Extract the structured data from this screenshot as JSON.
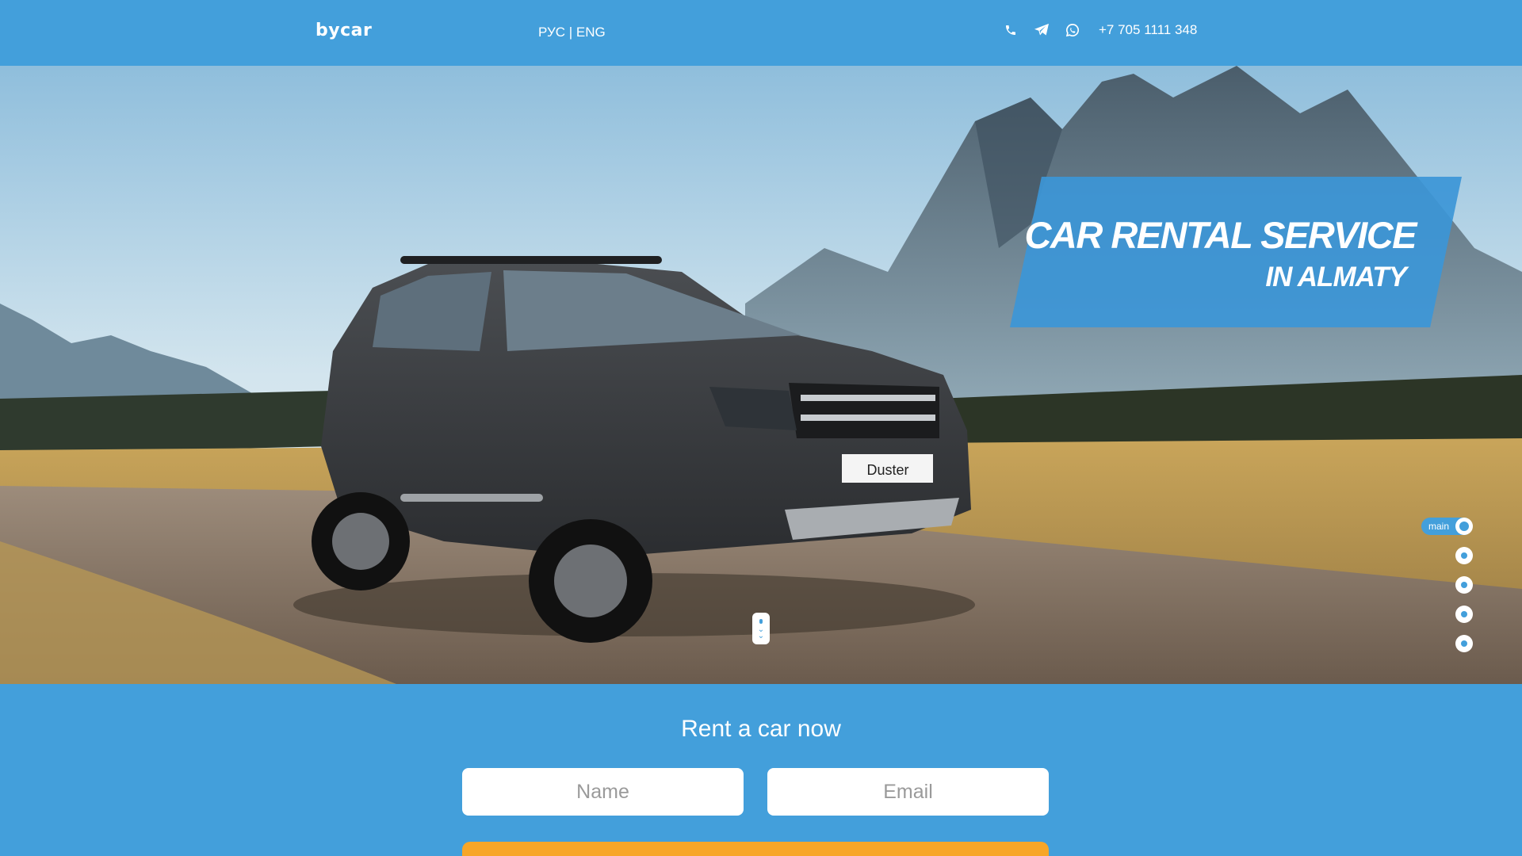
{
  "header": {
    "logo": "bycar",
    "lang_ru": "РУС",
    "lang_sep": " | ",
    "lang_en": "ENG",
    "icons": [
      "phone-icon",
      "telegram-icon",
      "whatsapp-icon"
    ],
    "phone": "+7 705 1111 348"
  },
  "hero": {
    "title_line1": "CAR RENTAL SERVICE",
    "title_line2": "IN ALMATY",
    "car_plate": "Duster",
    "nav": {
      "active_label": "main",
      "dot_count": 5
    }
  },
  "form": {
    "title": "Rent a car now",
    "name_placeholder": "Name",
    "email_placeholder": "Email"
  },
  "colors": {
    "brand_blue": "#439fdb",
    "accent_orange": "#f7a628"
  }
}
